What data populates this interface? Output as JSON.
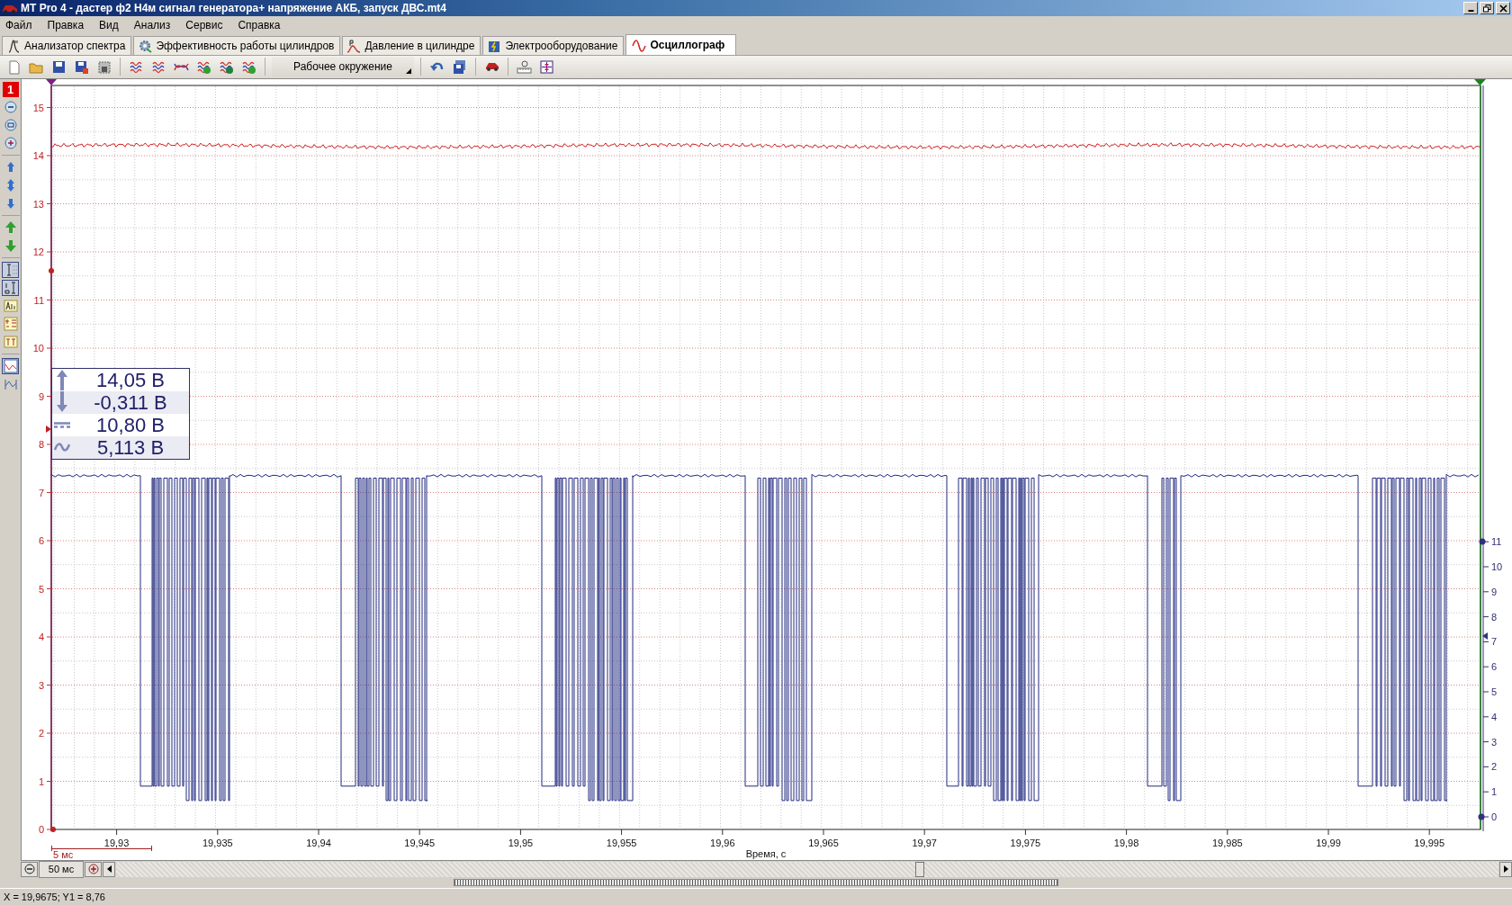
{
  "window": {
    "title": "MT Pro 4 - дастер ф2 Н4м сигнал генератора+ напряжение АКБ, запуск ДВС.mt4"
  },
  "menu": [
    "Файл",
    "Правка",
    "Вид",
    "Анализ",
    "Сервис",
    "Справка"
  ],
  "tabs": [
    {
      "label": "Анализатор спектра",
      "kind": "spectrum",
      "selected": false
    },
    {
      "label": "Эффективность работы цилиндров",
      "kind": "gear",
      "selected": false
    },
    {
      "label": "Давление в цилиндре",
      "kind": "pressure",
      "selected": false
    },
    {
      "label": "Электрооборудование",
      "kind": "battery",
      "selected": false
    },
    {
      "label": "Осциллограф",
      "kind": "wave",
      "selected": true
    }
  ],
  "toolbar": [
    {
      "kind": "new"
    },
    {
      "kind": "open"
    },
    {
      "kind": "save"
    },
    {
      "kind": "saveas"
    },
    {
      "kind": "disk"
    },
    {
      "kind": "sep"
    },
    {
      "kind": "waves"
    },
    {
      "kind": "waves"
    },
    {
      "kind": "cross"
    },
    {
      "kind": "wavecheck"
    },
    {
      "kind": "waveinfo"
    },
    {
      "kind": "wavecheck"
    },
    {
      "kind": "sep"
    },
    {
      "kind": "dropdown",
      "label": "Рабочее окружение"
    },
    {
      "kind": "sep"
    },
    {
      "kind": "undo"
    },
    {
      "kind": "saveall"
    },
    {
      "kind": "sep"
    },
    {
      "kind": "car"
    },
    {
      "kind": "sep"
    },
    {
      "kind": "ruler"
    },
    {
      "kind": "fit"
    }
  ],
  "side_tools": [
    {
      "kind": "badge",
      "label": "1"
    },
    {
      "kind": "zoomout",
      "pressed": false
    },
    {
      "kind": "zoomreset",
      "pressed": false
    },
    {
      "kind": "zoomin",
      "pressed": false
    },
    {
      "kind": "sep"
    },
    {
      "kind": "up",
      "pressed": false
    },
    {
      "kind": "updown",
      "pressed": false
    },
    {
      "kind": "down",
      "pressed": false
    },
    {
      "kind": "sep"
    },
    {
      "kind": "greenup",
      "pressed": false
    },
    {
      "kind": "greendown",
      "pressed": false
    },
    {
      "kind": "sep"
    },
    {
      "kind": "cursor",
      "pressed": true
    },
    {
      "kind": "cursor2",
      "pressed": true
    },
    {
      "kind": "text",
      "pressed": false
    },
    {
      "kind": "marks",
      "pressed": false
    },
    {
      "kind": "t1t2",
      "pressed": false
    },
    {
      "kind": "sep"
    },
    {
      "kind": "chart",
      "pressed": true
    },
    {
      "kind": "chart2",
      "pressed": false
    }
  ],
  "plot": {
    "left_axis": [
      "15",
      "14",
      "13",
      "12",
      "11",
      "10",
      "9",
      "8",
      "7",
      "6",
      "5",
      "4",
      "3",
      "2",
      "1",
      "0"
    ],
    "right_axis": [
      "11",
      "10",
      "9",
      "8",
      "7",
      "6",
      "5",
      "4",
      "3",
      "2",
      "1",
      "0"
    ],
    "x_axis": [
      "19,93",
      "19,935",
      "19,94",
      "19,945",
      "19,95",
      "19,955",
      "19,96",
      "19,965",
      "19,97",
      "19,975",
      "19,98",
      "19,985",
      "19,99",
      "19,995"
    ],
    "x_label": "Время, с",
    "scale": "5 мс",
    "readout": [
      {
        "kind": "max",
        "value": "14,05 В"
      },
      {
        "kind": "min",
        "value": "-0,311 В"
      },
      {
        "kind": "mean",
        "value": "10,80 В"
      },
      {
        "kind": "rms",
        "value": "5,113 В"
      }
    ]
  },
  "timebase": {
    "value": "50 мс"
  },
  "status_bar": "X = 19,9675; Y1 = 8,76"
}
